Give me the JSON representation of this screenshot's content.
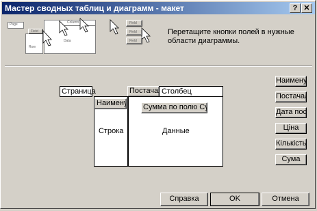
{
  "window": {
    "title": "Мастер сводных таблиц и диаграмм - макет"
  },
  "titlebar_buttons": {
    "help": "?",
    "close": "✕"
  },
  "instruction": "Перетащите кнопки полей в нужные области диаграммы.",
  "layout_areas": {
    "page": "Страница",
    "column": "Столбец",
    "column_field": "Постачал",
    "row": "Строка",
    "row_field": "Наименув",
    "data": "Данные",
    "data_field": "Сумма по полю Сум"
  },
  "field_buttons": [
    "Наименув",
    "Постачал",
    "Дата пос",
    "Ціна",
    "Кількість",
    "Сума"
  ],
  "buttons": {
    "help": "Справка",
    "ok": "OK",
    "cancel": "Отмена"
  },
  "illustration": {
    "page_label": "Page",
    "row_label": "Row",
    "column_label": "Column",
    "data_label": "Data",
    "field_label": "Field",
    "field_labels": [
      "Field",
      "Field",
      "Field"
    ]
  }
}
